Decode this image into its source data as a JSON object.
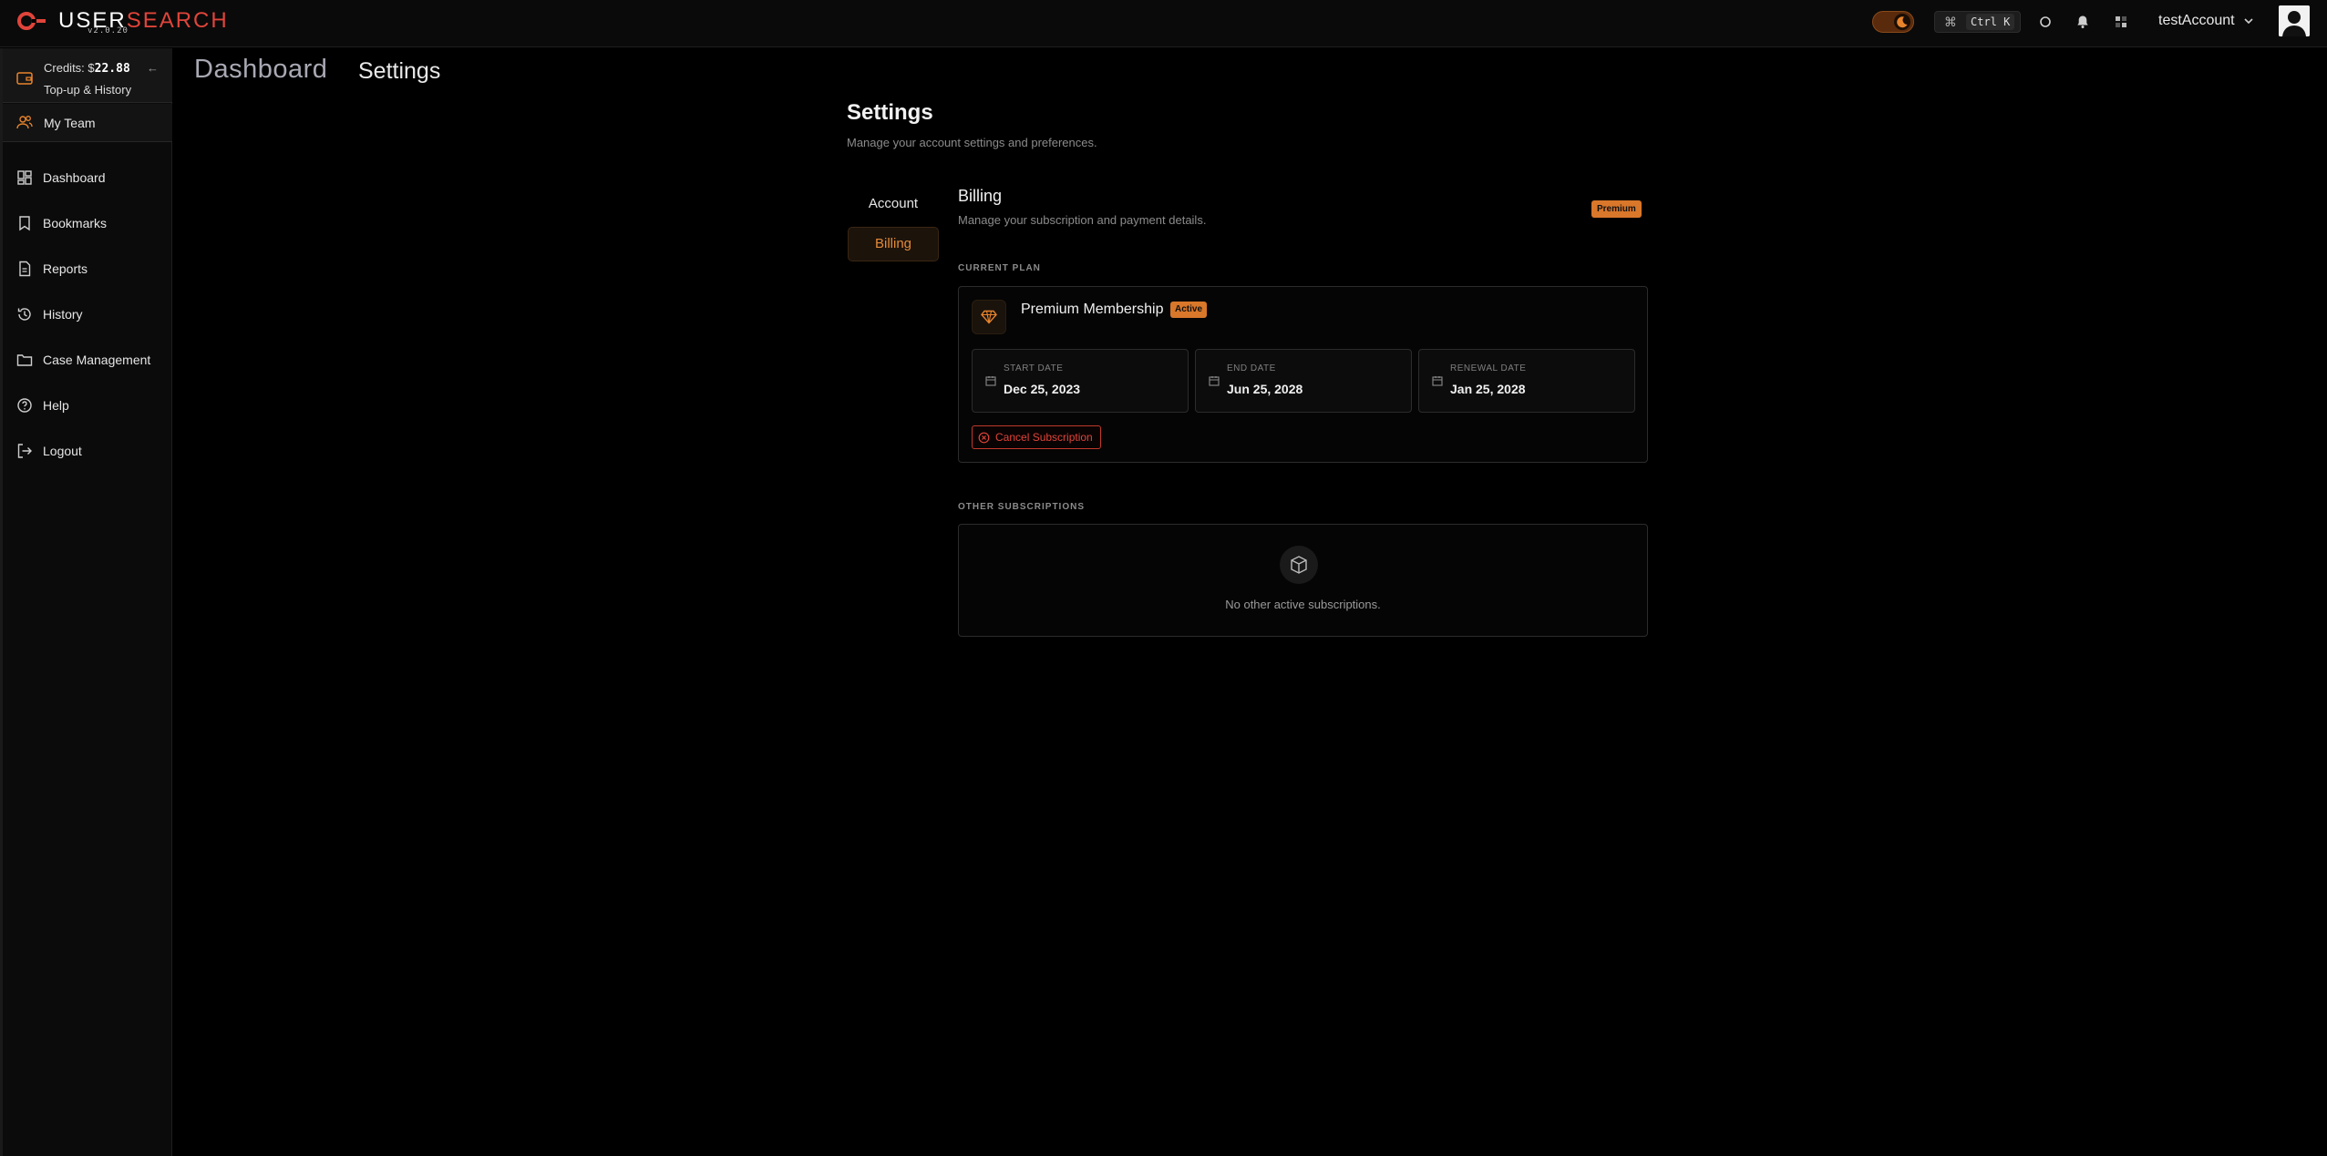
{
  "app": {
    "name_part1": "USER",
    "name_part2": "SEARCH",
    "version": "v2.0.20"
  },
  "topbar": {
    "shortcut_symbol": "⌘",
    "shortcut_keys": "Ctrl K",
    "account_name": "testAccount"
  },
  "sidebar": {
    "credits_label": "Credits: $",
    "credits_amount": "22.88",
    "topup_label": "Top-up & History",
    "team_label": "My Team",
    "items": [
      {
        "label": "Dashboard",
        "icon": "dashboard-icon"
      },
      {
        "label": "Bookmarks",
        "icon": "bookmark-icon"
      },
      {
        "label": "Reports",
        "icon": "report-icon"
      },
      {
        "label": "History",
        "icon": "history-icon"
      },
      {
        "label": "Case Management",
        "icon": "folder-icon"
      },
      {
        "label": "Help",
        "icon": "help-icon"
      },
      {
        "label": "Logout",
        "icon": "logout-icon"
      }
    ]
  },
  "breadcrumb": {
    "dashboard": "Dashboard",
    "settings": "Settings"
  },
  "settings": {
    "title": "Settings",
    "subtitle": "Manage your account settings and preferences.",
    "tabs": {
      "account": "Account",
      "billing": "Billing"
    }
  },
  "billing": {
    "title": "Billing",
    "subtitle": "Manage your subscription and payment details.",
    "badge": "Premium",
    "current_plan_label": "CURRENT PLAN",
    "plan_name": "Premium Membership",
    "plan_status": "Active",
    "start_label": "START DATE",
    "start_value": "Dec 25, 2023",
    "end_label": "END DATE",
    "end_value": "Jun 25, 2028",
    "renewal_label": "RENEWAL DATE",
    "renewal_value": "Jan 25, 2028",
    "cancel_label": "Cancel Subscription",
    "other_label": "OTHER SUBSCRIPTIONS",
    "other_empty": "No other active subscriptions."
  },
  "colors": {
    "accent": "#d9772a",
    "danger": "#e0443a",
    "background": "#000000"
  }
}
